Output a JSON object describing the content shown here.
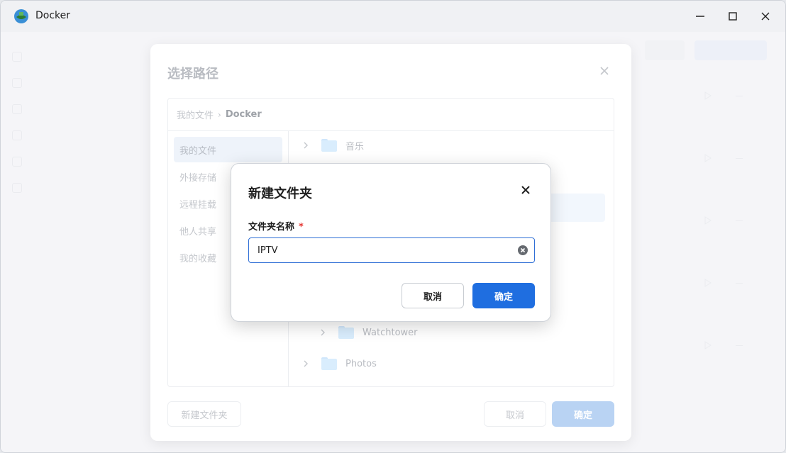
{
  "window": {
    "title": "Docker",
    "controls": [
      "minimize-icon",
      "maximize-icon",
      "close-icon"
    ]
  },
  "path_dialog": {
    "title": "选择路径",
    "breadcrumb": [
      "我的文件",
      "Docker"
    ],
    "sidebar": [
      {
        "label": "我的文件",
        "active": true
      },
      {
        "label": "外接存储",
        "active": false
      },
      {
        "label": "远程挂载",
        "active": false
      },
      {
        "label": "他人共享",
        "active": false
      },
      {
        "label": "我的收藏",
        "active": false
      }
    ],
    "tree": [
      {
        "label": "音乐",
        "indent": 0
      },
      {
        "label": "Watchtower",
        "indent": 1
      },
      {
        "label": "Photos",
        "indent": 0
      }
    ],
    "new_folder_label": "新建文件夹",
    "cancel_label": "取消",
    "ok_label": "确定"
  },
  "new_folder_modal": {
    "title": "新建文件夹",
    "field_label": "文件夹名称",
    "required_mark": "*",
    "input_value": "IPTV",
    "cancel_label": "取消",
    "ok_label": "确定"
  },
  "colors": {
    "accent": "#1f6ee0",
    "accent_disabled": "#b9d3f3",
    "required": "#e53935"
  }
}
